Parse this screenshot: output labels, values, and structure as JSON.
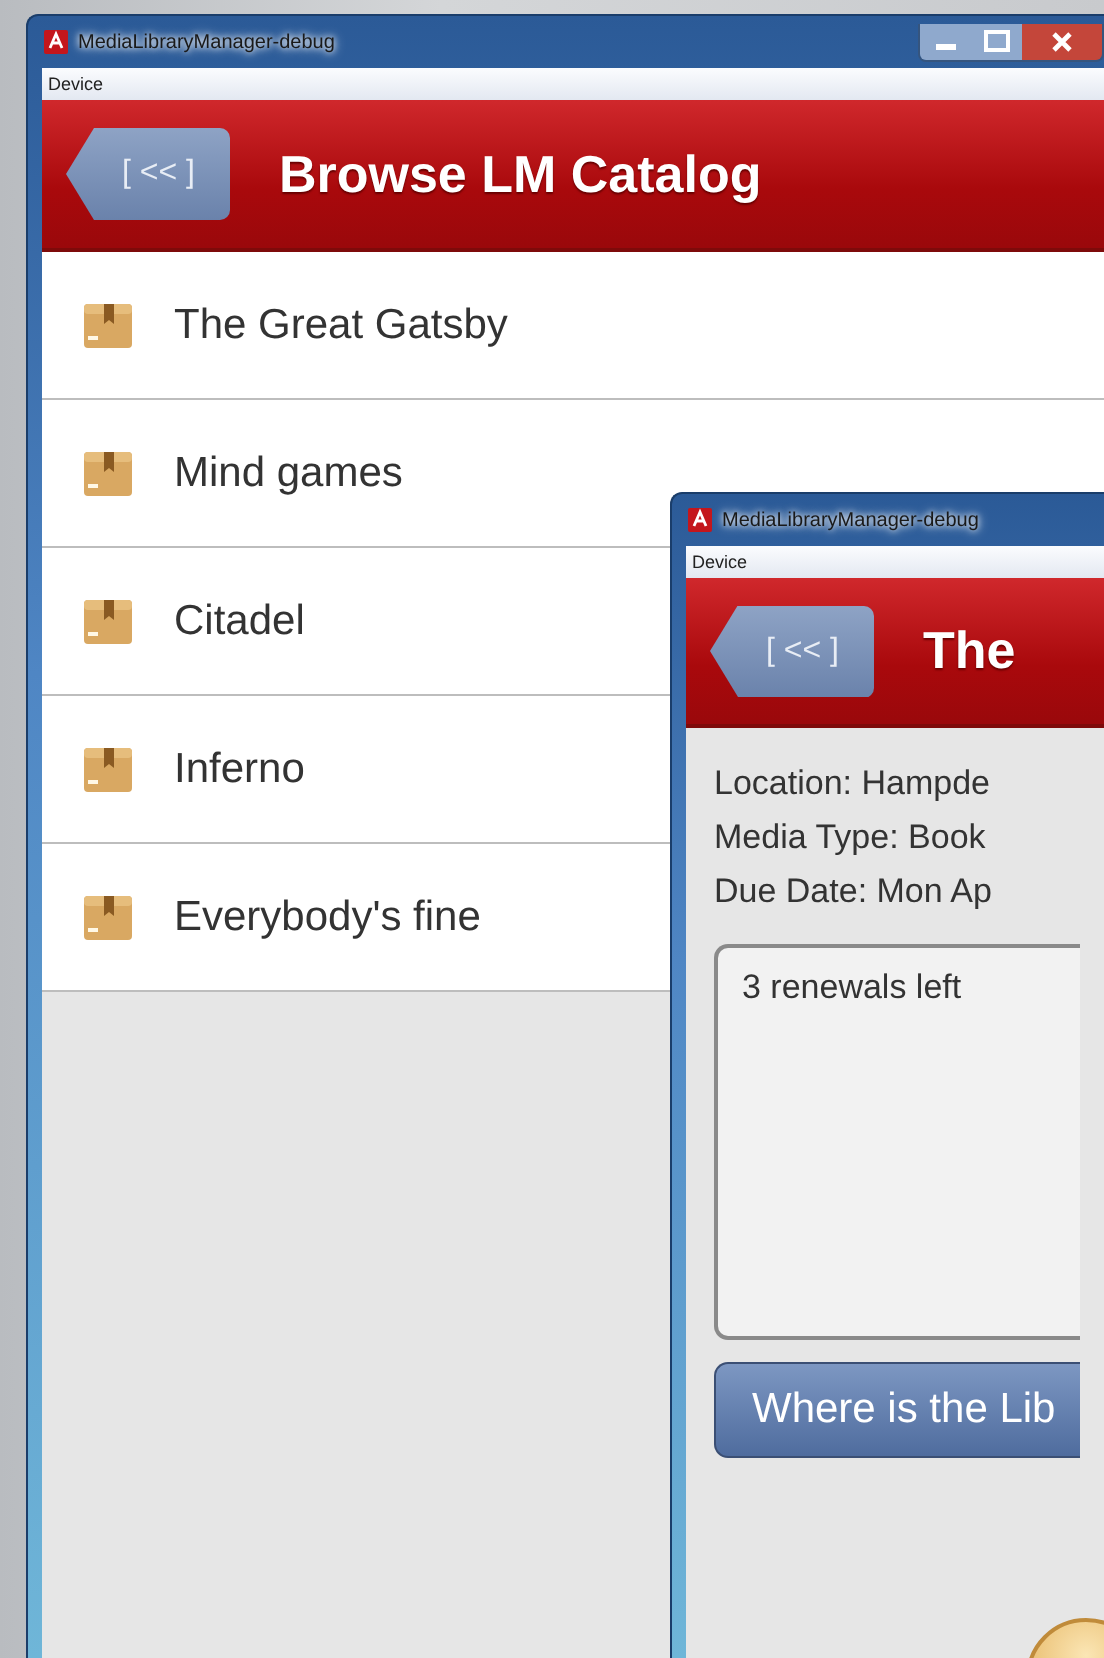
{
  "windows": [
    {
      "kind": "list",
      "title": "MediaLibraryManager-debug",
      "menu": [
        "Device"
      ],
      "header": {
        "back_button": "[ << ]",
        "title": "Browse LM Catalog"
      },
      "items": [
        {
          "label": "The Great Gatsby"
        },
        {
          "label": "Mind games"
        },
        {
          "label": "Citadel"
        },
        {
          "label": "Inferno"
        },
        {
          "label": "Everybody's fine"
        }
      ]
    },
    {
      "kind": "detail",
      "title": "MediaLibraryManager-debug",
      "menu": [
        "Device"
      ],
      "header": {
        "back_button": "[ << ]",
        "title": "The"
      },
      "details": [
        "Location: Hampde",
        "Media Type: Book",
        "Due Date: Mon Ap"
      ],
      "notes": "3 renewals left",
      "action_button": "Where is the Lib"
    }
  ]
}
